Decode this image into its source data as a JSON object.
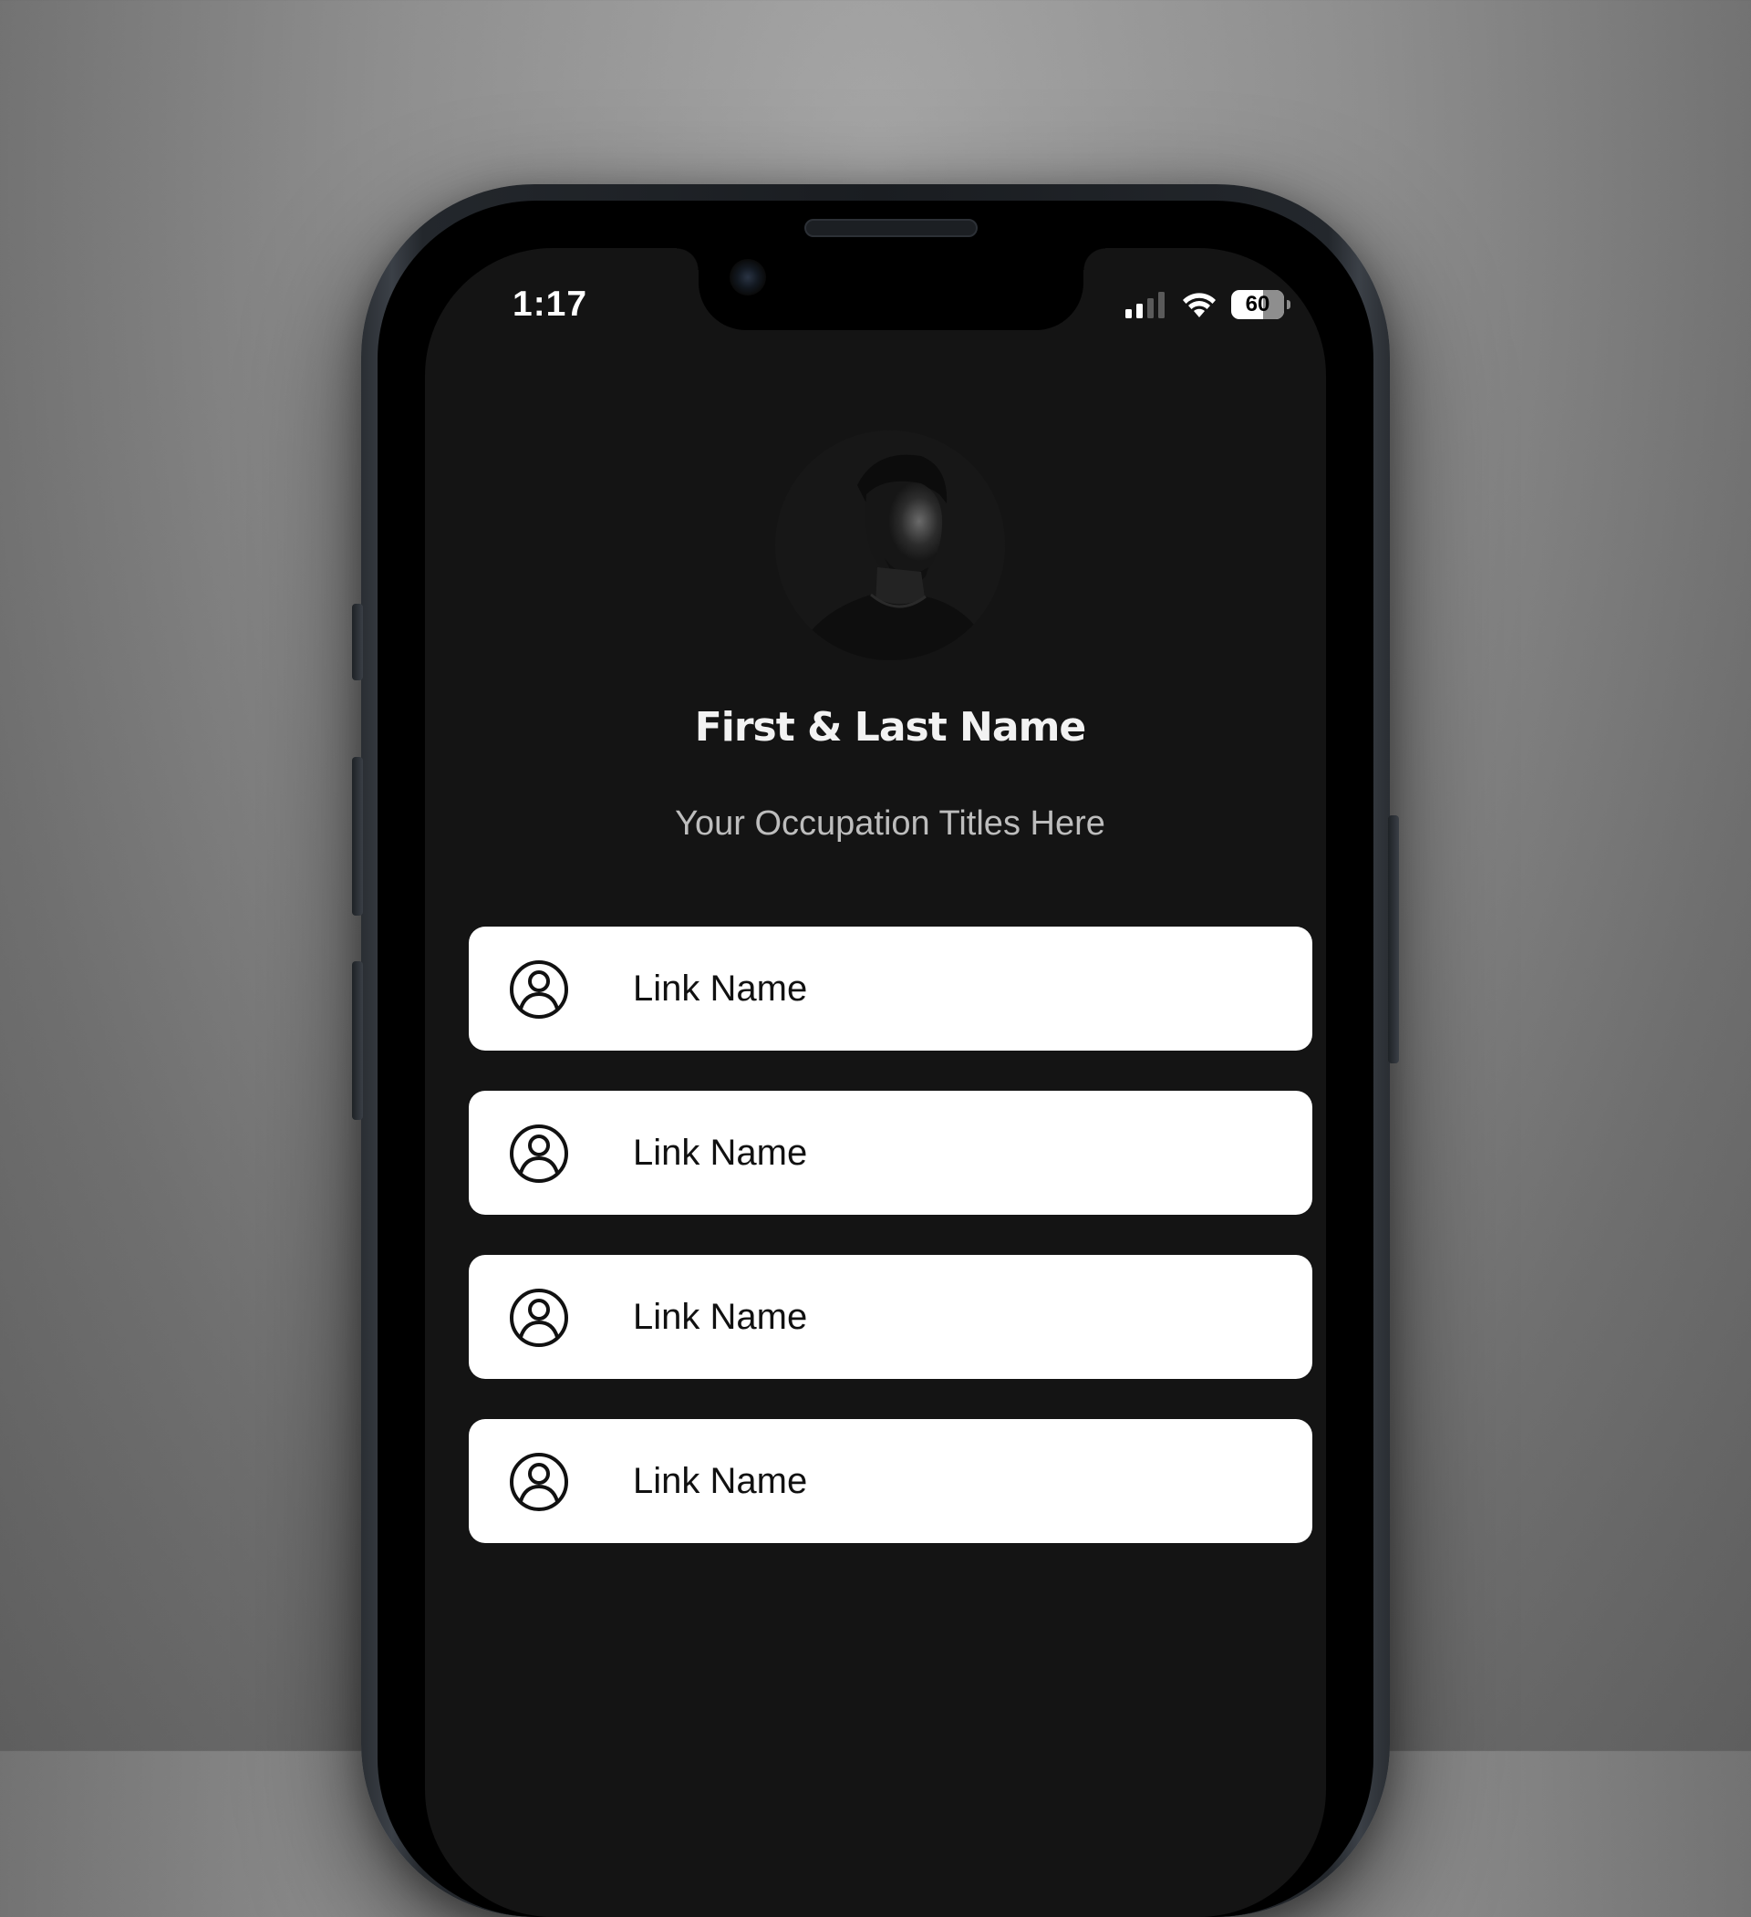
{
  "status_bar": {
    "time": "1:17",
    "battery": "60"
  },
  "profile": {
    "name": "First & Last Name",
    "occupation": "Your Occupation Titles Here"
  },
  "links": [
    {
      "label": "Link Name",
      "icon": "user-circle-icon"
    },
    {
      "label": "Link Name",
      "icon": "user-circle-icon"
    },
    {
      "label": "Link Name",
      "icon": "user-circle-icon"
    },
    {
      "label": "Link Name",
      "icon": "user-circle-icon"
    }
  ],
  "colors": {
    "screen_background": "#141414",
    "link_background": "#ffffff",
    "page_background": "#8e8e8e"
  }
}
